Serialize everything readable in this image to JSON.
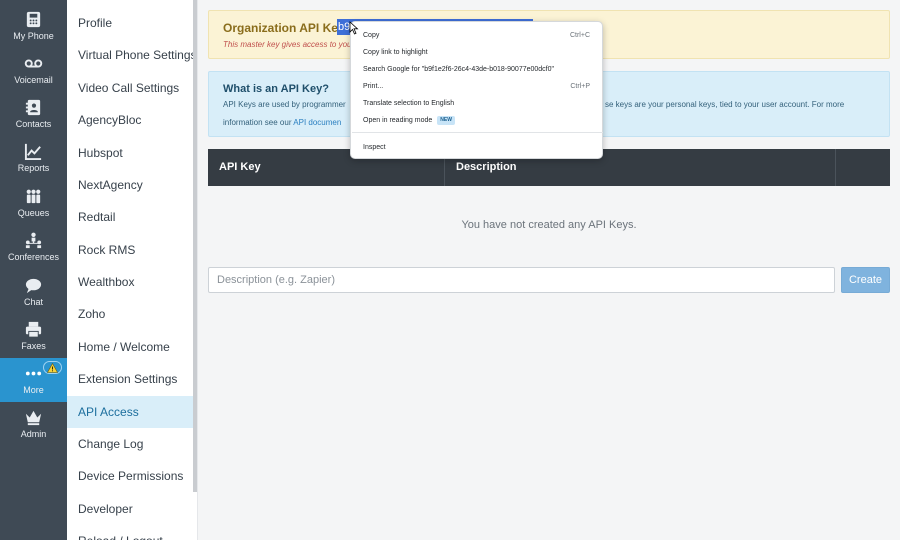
{
  "rail": [
    {
      "label": "My Phone",
      "icon": "phone-icon"
    },
    {
      "label": "Voicemail",
      "icon": "voicemail-icon"
    },
    {
      "label": "Contacts",
      "icon": "contacts-icon"
    },
    {
      "label": "Reports",
      "icon": "reports-icon"
    },
    {
      "label": "Queues",
      "icon": "queues-icon"
    },
    {
      "label": "Conferences",
      "icon": "conferences-icon"
    },
    {
      "label": "Chat",
      "icon": "chat-icon"
    },
    {
      "label": "Faxes",
      "icon": "fax-icon"
    },
    {
      "label": "More",
      "icon": "more-icon",
      "active": true
    },
    {
      "label": "Admin",
      "icon": "admin-crown-icon"
    }
  ],
  "subnav": [
    {
      "label": "Profile"
    },
    {
      "label": "Virtual Phone Settings"
    },
    {
      "label": "Video Call Settings"
    },
    {
      "label": "AgencyBloc"
    },
    {
      "label": "Hubspot"
    },
    {
      "label": "NextAgency"
    },
    {
      "label": "Redtail"
    },
    {
      "label": "Rock RMS"
    },
    {
      "label": "Wealthbox"
    },
    {
      "label": "Zoho"
    },
    {
      "label": "Home / Welcome"
    },
    {
      "label": "Extension Settings"
    },
    {
      "label": "API Access",
      "active": true
    },
    {
      "label": "Change Log"
    },
    {
      "label": "Device Permissions"
    },
    {
      "label": "Developer"
    },
    {
      "label": "Reload / Logout"
    }
  ],
  "org_card": {
    "title": "Organization API Key:",
    "key_value": "b9f",
    "note": "This master key gives access to you"
  },
  "info_card": {
    "title": "What is an API Key?",
    "text_1": "API Keys are used by programmer",
    "text_1b": "se keys are your personal keys, tied to your user account. For more",
    "text_2_prefix": "information see our ",
    "link": "API documen"
  },
  "table": {
    "headers": [
      "API Key",
      "Description",
      ""
    ],
    "empty_message": "You have not created any API Keys."
  },
  "form": {
    "placeholder": "Description (e.g. Zapier)",
    "value": "",
    "create_label": "Create"
  },
  "context_menu": {
    "items": [
      {
        "label": "Copy",
        "shortcut": "Ctrl+C"
      },
      {
        "label": "Copy link to highlight",
        "shortcut": ""
      },
      {
        "label": "Search Google for \"b9f1e2f6-26c4-43de-b018-90077e00dcf0\"",
        "shortcut": ""
      },
      {
        "label": "Print...",
        "shortcut": "Ctrl+P"
      },
      {
        "label": "Translate selection to English",
        "shortcut": ""
      },
      {
        "label": "Open in reading mode",
        "shortcut": "",
        "badge": "NEW"
      },
      {
        "label": "Inspect",
        "shortcut": ""
      }
    ]
  },
  "colors": {
    "rail_bg": "#3f4a55",
    "rail_active": "#2a94cf",
    "subnav_active": "#d9eef9",
    "warning_card": "#fbf3d5",
    "info_card": "#d9eef9",
    "table_header": "#353c43",
    "create_button": "#7fb3de",
    "selection": "#3e6fd8"
  }
}
